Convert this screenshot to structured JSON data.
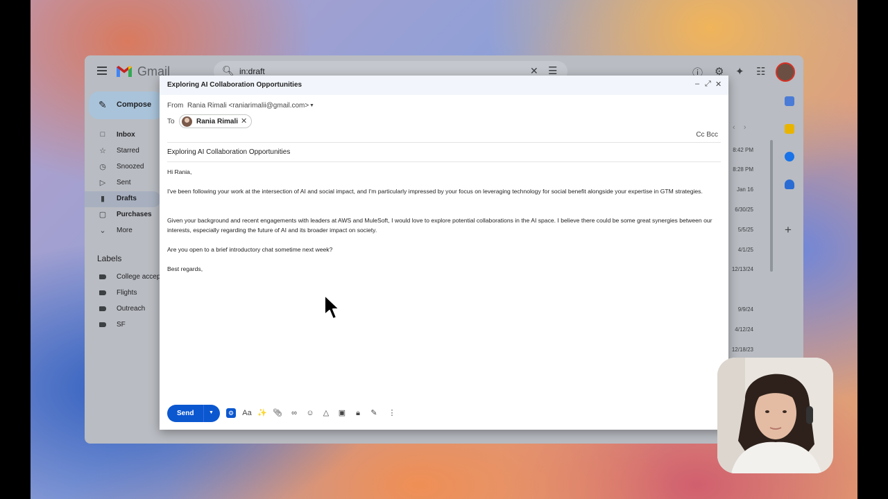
{
  "gmail": {
    "app_name": "Gmail",
    "search_value": "in:draft",
    "compose_label": "Compose",
    "nav": [
      {
        "label": "Inbox",
        "icon": "inbox-icon"
      },
      {
        "label": "Starred",
        "icon": "star-icon"
      },
      {
        "label": "Snoozed",
        "icon": "clock-icon"
      },
      {
        "label": "Sent",
        "icon": "send-icon"
      },
      {
        "label": "Drafts",
        "icon": "draft-icon"
      },
      {
        "label": "Purchases",
        "icon": "bag-icon"
      },
      {
        "label": "More",
        "icon": "chevron-down-icon"
      }
    ],
    "labels_heading": "Labels",
    "labels": [
      "College accep",
      "Flights",
      "Outreach",
      "SF"
    ],
    "dates": [
      "8:42 PM",
      "8:28 PM",
      "Jan 16",
      "6/30/25",
      "5/5/25",
      "4/1/25",
      "12/13/24",
      "9/9/24",
      "4/12/24",
      "12/18/23"
    ]
  },
  "compose": {
    "title": "Exploring AI Collaboration Opportunities",
    "from_label": "From",
    "from_value": "Rania Rimali <raniarimalii@gmail.com>",
    "to_label": "To",
    "recipient": "Rania Rimali",
    "cc_bcc": "Cc Bcc",
    "subject": "Exploring AI Collaboration Opportunities",
    "body": [
      "Hi Rania,",
      "I've been following your work at the intersection of AI and social impact, and I'm particularly impressed by your focus on leveraging technology for social benefit alongside your expertise in GTM strategies.",
      "Given your background and recent engagements with leaders at AWS and MuleSoft, I would love to explore potential collaborations in the AI space. I believe there could be some great synergies between our interests, especially regarding the future of AI and its broader impact on society.",
      "Are you open to a brief introductory chat sometime next week?",
      "Best regards,"
    ],
    "send_label": "Send",
    "format_label": "Aa"
  },
  "colors": {
    "send_blue": "#0b57d0",
    "dialog_header": "#f2f6fc",
    "gmail_red": "#d93025"
  }
}
